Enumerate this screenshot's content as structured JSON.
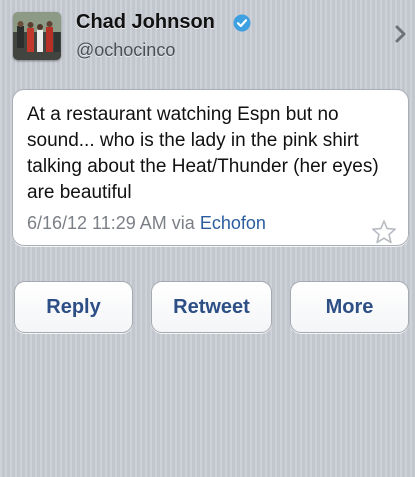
{
  "profile": {
    "display_name": "Chad Johnson",
    "handle": "@ochocinco",
    "verified": true
  },
  "tweet": {
    "text": "At a restaurant watching Espn but no sound... who is the lady in the pink shirt talking about the Heat/Thunder (her eyes) are beautiful",
    "timestamp": "6/16/12 11:29 AM",
    "via_label": "via",
    "source": "Echofon"
  },
  "actions": {
    "reply_label": "Reply",
    "retweet_label": "Retweet",
    "more_label": "More"
  },
  "icons": {
    "verified": "verified-badge-icon",
    "chevron": "chevron-right-icon",
    "favorite": "star-icon"
  },
  "colors": {
    "background": "#c8ccd4",
    "button_text": "#2d4f86",
    "link": "#2a5c9e",
    "verified": "#3ea0e0"
  }
}
